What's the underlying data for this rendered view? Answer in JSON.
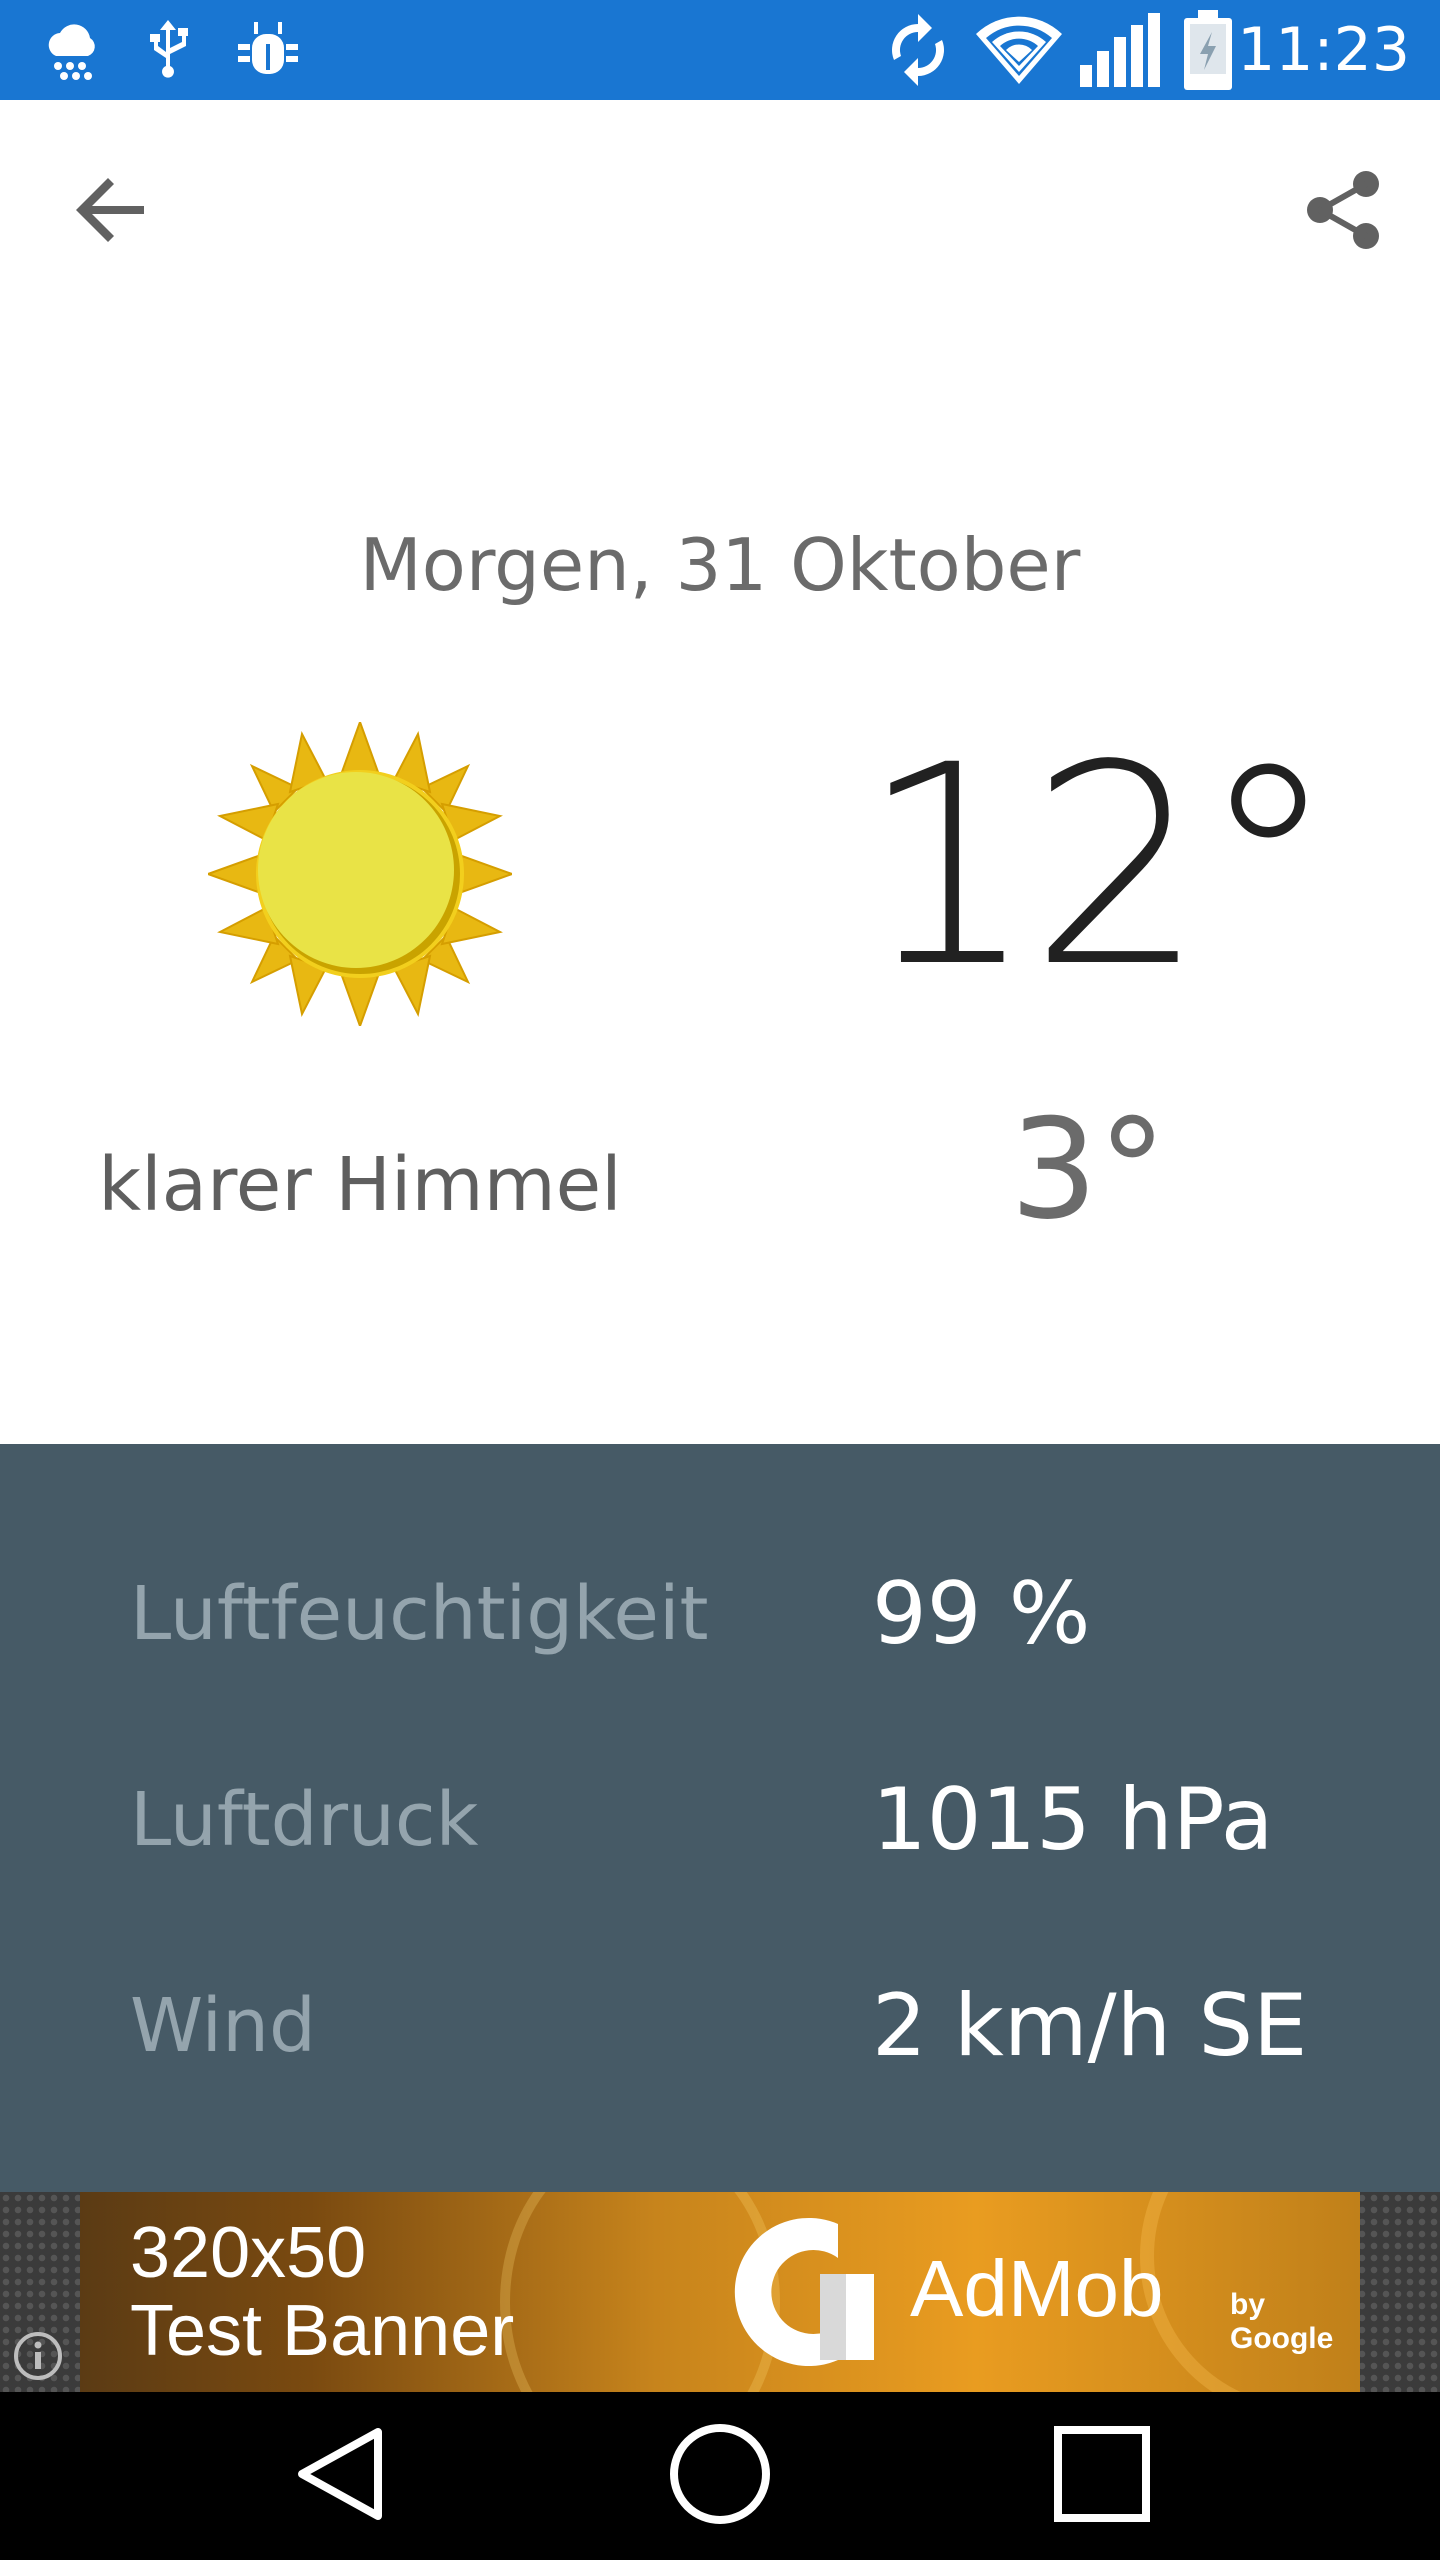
{
  "status_bar": {
    "time": "11:23",
    "left_icons": [
      "weather-rain-icon",
      "usb-icon",
      "debug-bug-icon"
    ],
    "right_icons": [
      "sync-icon",
      "wifi-icon",
      "cell-signal-icon",
      "battery-charging-icon"
    ],
    "color": "#1976d2"
  },
  "toolbar": {
    "back_icon": "arrow-back-icon",
    "share_icon": "share-icon"
  },
  "forecast": {
    "date": "Morgen, 31 Oktober",
    "condition": "klarer Himmel",
    "condition_icon": "sun-icon",
    "temp_high": "12°",
    "temp_low": "3°"
  },
  "details": {
    "background": "#465a66",
    "rows": [
      {
        "label": "Luftfeuchtigkeit",
        "value": "99 %"
      },
      {
        "label": "Luftdruck",
        "value": "1015 hPa"
      },
      {
        "label": "Wind",
        "value": "2 km/h SE"
      }
    ]
  },
  "ad": {
    "text": "320x50\nTest Banner",
    "brand": "AdMob",
    "by": "by Google",
    "info_icon": "info-icon"
  },
  "nav_bar": {
    "buttons": [
      "back-triangle-icon",
      "home-circle-icon",
      "recents-square-icon"
    ]
  }
}
